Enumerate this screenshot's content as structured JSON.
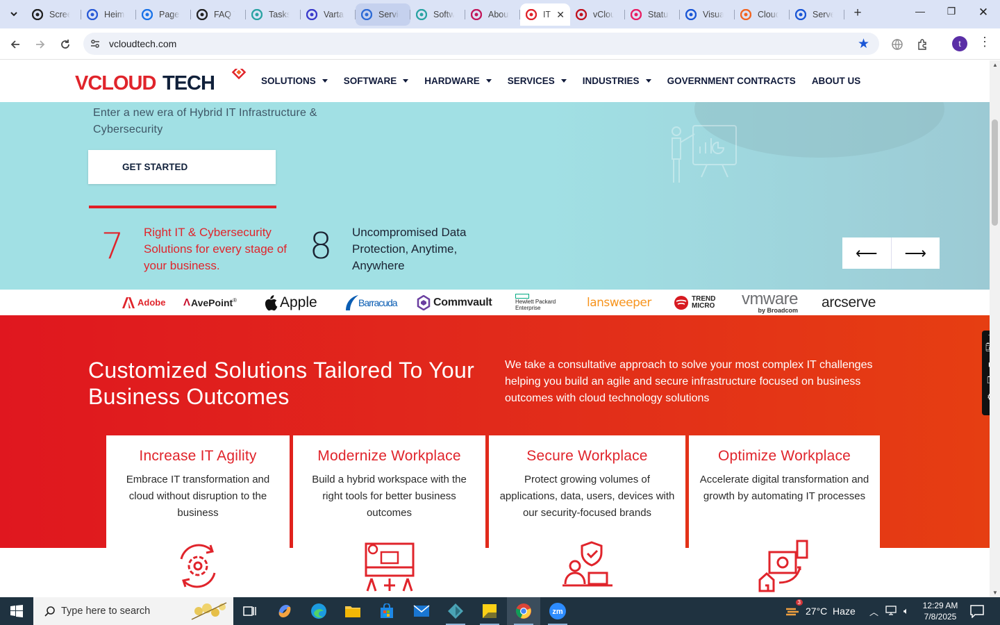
{
  "browser": {
    "tabs": [
      {
        "title": "Screencastify",
        "icon": "screencast-icon",
        "color": "#222"
      },
      {
        "title": "Heimdal",
        "icon": "heimdal-icon",
        "color": "#2a5bd7"
      },
      {
        "title": "PageSpeed",
        "icon": "pagespeed-icon",
        "color": "#1a73e8"
      },
      {
        "title": "FAQ TDR",
        "icon": "faq-icon",
        "color": "#222"
      },
      {
        "title": "Tasks",
        "icon": "tasks-icon",
        "color": "#2aa3a3"
      },
      {
        "title": "Vartana",
        "icon": "vartana-icon",
        "color": "#3a3acb"
      },
      {
        "title": "Service",
        "icon": "service-icon",
        "color": "#2e6bd6"
      },
      {
        "title": "Software",
        "icon": "software-icon",
        "color": "#2aa3a3"
      },
      {
        "title": "About",
        "icon": "about-icon",
        "color": "#c2185b"
      },
      {
        "title": "IT",
        "icon": "vcloud-icon",
        "color": "#e0242b"
      },
      {
        "title": "vCloud",
        "icon": "vcloud-v-icon",
        "color": "#c1121f"
      },
      {
        "title": "Status",
        "icon": "status-icon",
        "color": "#e91e63"
      },
      {
        "title": "Visual",
        "icon": "visual-icon",
        "color": "#1a56d6"
      },
      {
        "title": "Cloud",
        "icon": "cloud-icon",
        "color": "#f26522"
      },
      {
        "title": "Server",
        "icon": "docs-icon",
        "color": "#1a56d6"
      }
    ],
    "active_tab_index": 9,
    "url": "vcloudtech.com",
    "profile_initial": "t"
  },
  "site": {
    "logo_text": "VCLOUD TECH",
    "nav": [
      {
        "label": "SOLUTIONS",
        "dropdown": true
      },
      {
        "label": "SOFTWARE",
        "dropdown": true
      },
      {
        "label": "HARDWARE",
        "dropdown": true
      },
      {
        "label": "SERVICES",
        "dropdown": true
      },
      {
        "label": "INDUSTRIES",
        "dropdown": true
      },
      {
        "label": "GOVERNMENT CONTRACTS",
        "dropdown": false
      },
      {
        "label": "ABOUT US",
        "dropdown": false
      }
    ],
    "hero": {
      "subtitle": "Enter a new era of Hybrid IT Infrastructure & Cybersecurity",
      "cta": "GET STARTED",
      "stats": [
        {
          "number": "7",
          "text": "Right IT & Cybersecurity Solutions for every stage of your business."
        },
        {
          "number": "8",
          "text": "Uncompromised Data Protection, Anytime, Anywhere"
        }
      ],
      "prev_arrow": "⟵",
      "next_arrow": "⟶"
    },
    "brands": [
      "Adobe",
      "AvePoint",
      "Apple",
      "Barracuda",
      "Commvault",
      "Hewlett Packard Enterprise",
      "lansweeper",
      "TREND MICRO",
      "vmware",
      "by Broadcom",
      "arcserve"
    ],
    "solutions": {
      "title": "Customized Solutions Tailored To Your Business Outcomes",
      "description": "We take a consultative approach to solve your most complex IT challenges helping you build an agile and secure infrastructure focused on business outcomes with cloud technology solutions",
      "cards": [
        {
          "title": "Increase IT Agility",
          "text": "Embrace IT transformation and cloud without disruption to the business"
        },
        {
          "title": "Modernize Workplace",
          "text": "Build a hybrid workspace with the right tools for better business outcomes"
        },
        {
          "title": "Secure Workplace",
          "text": "Protect growing volumes of applications, data, users, devices with our security-focused brands"
        },
        {
          "title": "Optimize Workplace",
          "text": "Accelerate digital transformation and growth by automating IT processes"
        }
      ]
    }
  },
  "taskbar": {
    "search_placeholder": "Type here to search",
    "weather": "27°C  Haze",
    "weather_badge": "3",
    "time": "12:29 AM",
    "date": "7/8/2025"
  },
  "colors": {
    "accent_red": "#e0242b",
    "hero_bg": "#a1e0e4",
    "navy": "#101a3a"
  }
}
